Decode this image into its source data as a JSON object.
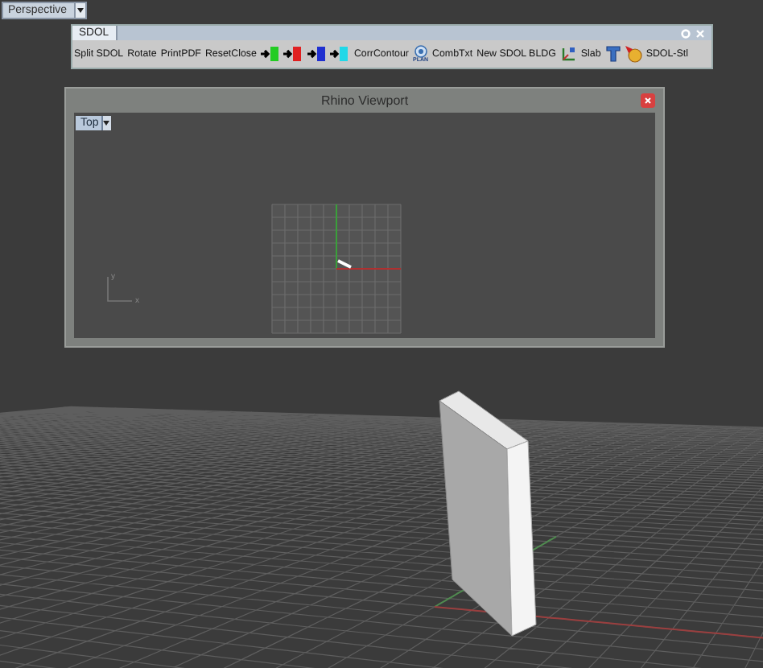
{
  "viewport_tab": {
    "label": "Perspective"
  },
  "toolbar": {
    "tab": "SDOL",
    "items": [
      {
        "kind": "text",
        "label": "Split SDOL"
      },
      {
        "kind": "text",
        "label": "Rotate"
      },
      {
        "kind": "text",
        "label": "PrintPDF"
      },
      {
        "kind": "text",
        "label": "ResetClose"
      },
      {
        "kind": "arrow",
        "color": "#22cc22"
      },
      {
        "kind": "arrow",
        "color": "#e02020"
      },
      {
        "kind": "arrow",
        "color": "#2030d0"
      },
      {
        "kind": "arrow",
        "color": "#20d8e8"
      },
      {
        "kind": "text",
        "label": "CorrContour"
      },
      {
        "kind": "plan",
        "badge": "PLAN"
      },
      {
        "kind": "text",
        "label": "CombTxt"
      },
      {
        "kind": "text",
        "label": "New SDOL BLDG"
      },
      {
        "kind": "slab",
        "label": "Slab"
      },
      {
        "kind": "tool"
      },
      {
        "kind": "stl",
        "label": "SDOL-Stl"
      }
    ]
  },
  "floating_viewport": {
    "title": "Rhino Viewport",
    "view": {
      "label": "Top"
    },
    "axis_labels": [
      "y",
      "x"
    ]
  }
}
